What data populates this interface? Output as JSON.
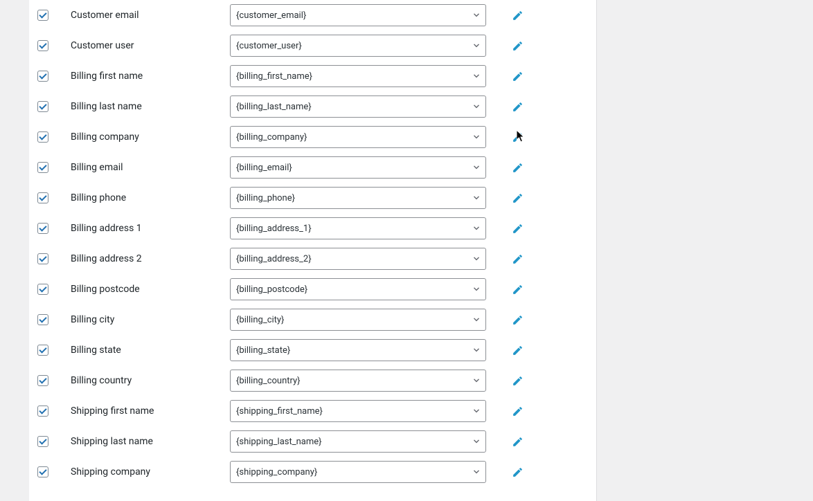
{
  "colors": {
    "accent": "#2196c8",
    "check": "#2271b1",
    "border": "#8c8f94",
    "chevron": "#666970"
  },
  "fields": [
    {
      "label": "Customer email",
      "value": "{customer_email}",
      "checked": true
    },
    {
      "label": "Customer user",
      "value": "{customer_user}",
      "checked": true
    },
    {
      "label": "Billing first name",
      "value": "{billing_first_name}",
      "checked": true
    },
    {
      "label": "Billing last name",
      "value": "{billing_last_name}",
      "checked": true
    },
    {
      "label": "Billing company",
      "value": "{billing_company}",
      "checked": true
    },
    {
      "label": "Billing email",
      "value": "{billing_email}",
      "checked": true
    },
    {
      "label": "Billing phone",
      "value": "{billing_phone}",
      "checked": true
    },
    {
      "label": "Billing address 1",
      "value": "{billing_address_1}",
      "checked": true
    },
    {
      "label": "Billing address 2",
      "value": "{billing_address_2}",
      "checked": true
    },
    {
      "label": "Billing postcode",
      "value": "{billing_postcode}",
      "checked": true
    },
    {
      "label": "Billing city",
      "value": "{billing_city}",
      "checked": true
    },
    {
      "label": "Billing state",
      "value": "{billing_state}",
      "checked": true
    },
    {
      "label": "Billing country",
      "value": "{billing_country}",
      "checked": true
    },
    {
      "label": "Shipping first name",
      "value": "{shipping_first_name}",
      "checked": true
    },
    {
      "label": "Shipping last name",
      "value": "{shipping_last_name}",
      "checked": true
    },
    {
      "label": "Shipping company",
      "value": "{shipping_company}",
      "checked": true
    }
  ]
}
